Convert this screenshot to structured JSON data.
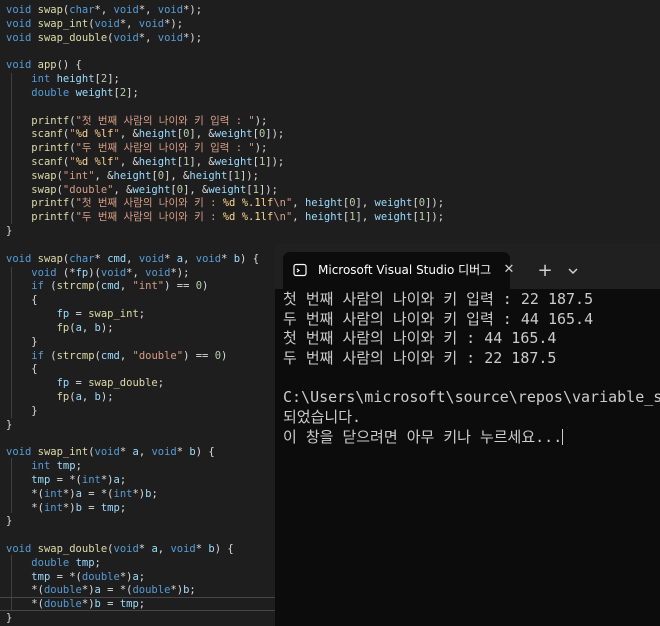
{
  "editor": {
    "lines": [
      [
        [
          "k",
          "void"
        ],
        [
          "p",
          " "
        ],
        [
          "f",
          "swap"
        ],
        [
          "p",
          "("
        ],
        [
          "k",
          "char"
        ],
        [
          "p",
          "*, "
        ],
        [
          "k",
          "void"
        ],
        [
          "p",
          "*, "
        ],
        [
          "k",
          "void"
        ],
        [
          "p",
          "*);"
        ]
      ],
      [
        [
          "k",
          "void"
        ],
        [
          "p",
          " "
        ],
        [
          "f",
          "swap_int"
        ],
        [
          "p",
          "("
        ],
        [
          "k",
          "void"
        ],
        [
          "p",
          "*, "
        ],
        [
          "k",
          "void"
        ],
        [
          "p",
          "*);"
        ]
      ],
      [
        [
          "k",
          "void"
        ],
        [
          "p",
          " "
        ],
        [
          "f",
          "swap_double"
        ],
        [
          "p",
          "("
        ],
        [
          "k",
          "void"
        ],
        [
          "p",
          "*, "
        ],
        [
          "k",
          "void"
        ],
        [
          "p",
          "*);"
        ]
      ],
      [],
      [
        [
          "k",
          "void"
        ],
        [
          "p",
          " "
        ],
        [
          "f",
          "app"
        ],
        [
          "p",
          "() {"
        ]
      ],
      [
        [
          "p",
          "    "
        ],
        [
          "k",
          "int"
        ],
        [
          "p",
          " "
        ],
        [
          "v",
          "height"
        ],
        [
          "p",
          "["
        ],
        [
          "n",
          "2"
        ],
        [
          "p",
          "];"
        ]
      ],
      [
        [
          "p",
          "    "
        ],
        [
          "k",
          "double"
        ],
        [
          "p",
          " "
        ],
        [
          "v",
          "weight"
        ],
        [
          "p",
          "["
        ],
        [
          "n",
          "2"
        ],
        [
          "p",
          "];"
        ]
      ],
      [],
      [
        [
          "p",
          "    "
        ],
        [
          "f",
          "printf"
        ],
        [
          "p",
          "("
        ],
        [
          "s",
          "\"첫 번째 사람의 나이와 키 입력 : \""
        ],
        [
          "p",
          ");"
        ]
      ],
      [
        [
          "p",
          "    "
        ],
        [
          "f",
          "scanf"
        ],
        [
          "p",
          "("
        ],
        [
          "s",
          "\""
        ],
        [
          "e",
          "%d %lf"
        ],
        [
          "s",
          "\""
        ],
        [
          "p",
          ", &"
        ],
        [
          "v",
          "height"
        ],
        [
          "p",
          "["
        ],
        [
          "n",
          "0"
        ],
        [
          "p",
          "], &"
        ],
        [
          "v",
          "weight"
        ],
        [
          "p",
          "["
        ],
        [
          "n",
          "0"
        ],
        [
          "p",
          "]);"
        ]
      ],
      [
        [
          "p",
          "    "
        ],
        [
          "f",
          "printf"
        ],
        [
          "p",
          "("
        ],
        [
          "s",
          "\"두 번째 사람의 나이와 키 입력 : \""
        ],
        [
          "p",
          ");"
        ]
      ],
      [
        [
          "p",
          "    "
        ],
        [
          "f",
          "scanf"
        ],
        [
          "p",
          "("
        ],
        [
          "s",
          "\""
        ],
        [
          "e",
          "%d %lf"
        ],
        [
          "s",
          "\""
        ],
        [
          "p",
          ", &"
        ],
        [
          "v",
          "height"
        ],
        [
          "p",
          "["
        ],
        [
          "n",
          "1"
        ],
        [
          "p",
          "], &"
        ],
        [
          "v",
          "weight"
        ],
        [
          "p",
          "["
        ],
        [
          "n",
          "1"
        ],
        [
          "p",
          "]);"
        ]
      ],
      [
        [
          "p",
          "    "
        ],
        [
          "f",
          "swap"
        ],
        [
          "p",
          "("
        ],
        [
          "s",
          "\"int\""
        ],
        [
          "p",
          ", &"
        ],
        [
          "v",
          "height"
        ],
        [
          "p",
          "["
        ],
        [
          "n",
          "0"
        ],
        [
          "p",
          "], &"
        ],
        [
          "v",
          "height"
        ],
        [
          "p",
          "["
        ],
        [
          "n",
          "1"
        ],
        [
          "p",
          "]);"
        ]
      ],
      [
        [
          "p",
          "    "
        ],
        [
          "f",
          "swap"
        ],
        [
          "p",
          "("
        ],
        [
          "s",
          "\"double\""
        ],
        [
          "p",
          ", &"
        ],
        [
          "v",
          "weight"
        ],
        [
          "p",
          "["
        ],
        [
          "n",
          "0"
        ],
        [
          "p",
          "], &"
        ],
        [
          "v",
          "weight"
        ],
        [
          "p",
          "["
        ],
        [
          "n",
          "1"
        ],
        [
          "p",
          "]);"
        ]
      ],
      [
        [
          "p",
          "    "
        ],
        [
          "f",
          "printf"
        ],
        [
          "p",
          "("
        ],
        [
          "s",
          "\"첫 번째 사람의 나이와 키 : "
        ],
        [
          "e",
          "%d %.1lf"
        ],
        [
          "s",
          "\\n\""
        ],
        [
          "p",
          ", "
        ],
        [
          "v",
          "height"
        ],
        [
          "p",
          "["
        ],
        [
          "n",
          "0"
        ],
        [
          "p",
          "], "
        ],
        [
          "v",
          "weight"
        ],
        [
          "p",
          "["
        ],
        [
          "n",
          "0"
        ],
        [
          "p",
          "]);"
        ]
      ],
      [
        [
          "p",
          "    "
        ],
        [
          "f",
          "printf"
        ],
        [
          "p",
          "("
        ],
        [
          "s",
          "\"두 번째 사람의 나이와 키 : "
        ],
        [
          "e",
          "%d %.1lf"
        ],
        [
          "s",
          "\\n\""
        ],
        [
          "p",
          ", "
        ],
        [
          "v",
          "height"
        ],
        [
          "p",
          "["
        ],
        [
          "n",
          "1"
        ],
        [
          "p",
          "], "
        ],
        [
          "v",
          "weight"
        ],
        [
          "p",
          "["
        ],
        [
          "n",
          "1"
        ],
        [
          "p",
          "]);"
        ]
      ],
      [
        [
          "p",
          "}"
        ]
      ],
      [],
      [
        [
          "k",
          "void"
        ],
        [
          "p",
          " "
        ],
        [
          "f",
          "swap"
        ],
        [
          "p",
          "("
        ],
        [
          "k",
          "char"
        ],
        [
          "p",
          "* "
        ],
        [
          "v",
          "cmd"
        ],
        [
          "p",
          ", "
        ],
        [
          "k",
          "void"
        ],
        [
          "p",
          "* "
        ],
        [
          "v",
          "a"
        ],
        [
          "p",
          ", "
        ],
        [
          "k",
          "void"
        ],
        [
          "p",
          "* "
        ],
        [
          "v",
          "b"
        ],
        [
          "p",
          ") {"
        ]
      ],
      [
        [
          "p",
          "    "
        ],
        [
          "k",
          "void"
        ],
        [
          "p",
          " (*"
        ],
        [
          "v",
          "fp"
        ],
        [
          "p",
          ")("
        ],
        [
          "k",
          "void"
        ],
        [
          "p",
          "*, "
        ],
        [
          "k",
          "void"
        ],
        [
          "p",
          "*);"
        ]
      ],
      [
        [
          "p",
          "    "
        ],
        [
          "k",
          "if"
        ],
        [
          "p",
          " ("
        ],
        [
          "f",
          "strcmp"
        ],
        [
          "p",
          "("
        ],
        [
          "v",
          "cmd"
        ],
        [
          "p",
          ", "
        ],
        [
          "s",
          "\"int\""
        ],
        [
          "p",
          ") == "
        ],
        [
          "n",
          "0"
        ],
        [
          "p",
          ")"
        ]
      ],
      [
        [
          "p",
          "    {"
        ]
      ],
      [
        [
          "p",
          "        "
        ],
        [
          "v",
          "fp"
        ],
        [
          "p",
          " = "
        ],
        [
          "f",
          "swap_int"
        ],
        [
          "p",
          ";"
        ]
      ],
      [
        [
          "p",
          "        "
        ],
        [
          "f",
          "fp"
        ],
        [
          "p",
          "("
        ],
        [
          "v",
          "a"
        ],
        [
          "p",
          ", "
        ],
        [
          "v",
          "b"
        ],
        [
          "p",
          ");"
        ]
      ],
      [
        [
          "p",
          "    }"
        ]
      ],
      [
        [
          "p",
          "    "
        ],
        [
          "k",
          "if"
        ],
        [
          "p",
          " ("
        ],
        [
          "f",
          "strcmp"
        ],
        [
          "p",
          "("
        ],
        [
          "v",
          "cmd"
        ],
        [
          "p",
          ", "
        ],
        [
          "s",
          "\"double\""
        ],
        [
          "p",
          ") == "
        ],
        [
          "n",
          "0"
        ],
        [
          "p",
          ")"
        ]
      ],
      [
        [
          "p",
          "    {"
        ]
      ],
      [
        [
          "p",
          "        "
        ],
        [
          "v",
          "fp"
        ],
        [
          "p",
          " = "
        ],
        [
          "f",
          "swap_double"
        ],
        [
          "p",
          ";"
        ]
      ],
      [
        [
          "p",
          "        "
        ],
        [
          "f",
          "fp"
        ],
        [
          "p",
          "("
        ],
        [
          "v",
          "a"
        ],
        [
          "p",
          ", "
        ],
        [
          "v",
          "b"
        ],
        [
          "p",
          ");"
        ]
      ],
      [
        [
          "p",
          "    }"
        ]
      ],
      [
        [
          "p",
          "}"
        ]
      ],
      [],
      [
        [
          "k",
          "void"
        ],
        [
          "p",
          " "
        ],
        [
          "f",
          "swap_int"
        ],
        [
          "p",
          "("
        ],
        [
          "k",
          "void"
        ],
        [
          "p",
          "* "
        ],
        [
          "v",
          "a"
        ],
        [
          "p",
          ", "
        ],
        [
          "k",
          "void"
        ],
        [
          "p",
          "* "
        ],
        [
          "v",
          "b"
        ],
        [
          "p",
          ") {"
        ]
      ],
      [
        [
          "p",
          "    "
        ],
        [
          "k",
          "int"
        ],
        [
          "p",
          " "
        ],
        [
          "v",
          "tmp"
        ],
        [
          "p",
          ";"
        ]
      ],
      [
        [
          "p",
          "    "
        ],
        [
          "v",
          "tmp"
        ],
        [
          "p",
          " = *("
        ],
        [
          "k",
          "int"
        ],
        [
          "p",
          "*)"
        ],
        [
          "v",
          "a"
        ],
        [
          "p",
          ";"
        ]
      ],
      [
        [
          "p",
          "    *("
        ],
        [
          "k",
          "int"
        ],
        [
          "p",
          "*)"
        ],
        [
          "v",
          "a"
        ],
        [
          "p",
          " = *("
        ],
        [
          "k",
          "int"
        ],
        [
          "p",
          "*)"
        ],
        [
          "v",
          "b"
        ],
        [
          "p",
          ";"
        ]
      ],
      [
        [
          "p",
          "    *("
        ],
        [
          "k",
          "int"
        ],
        [
          "p",
          "*)"
        ],
        [
          "v",
          "b"
        ],
        [
          "p",
          " = "
        ],
        [
          "v",
          "tmp"
        ],
        [
          "p",
          ";"
        ]
      ],
      [
        [
          "p",
          "}"
        ]
      ],
      [],
      [
        [
          "k",
          "void"
        ],
        [
          "p",
          " "
        ],
        [
          "f",
          "swap_double"
        ],
        [
          "p",
          "("
        ],
        [
          "k",
          "void"
        ],
        [
          "p",
          "* "
        ],
        [
          "v",
          "a"
        ],
        [
          "p",
          ", "
        ],
        [
          "k",
          "void"
        ],
        [
          "p",
          "* "
        ],
        [
          "v",
          "b"
        ],
        [
          "p",
          ") {"
        ]
      ],
      [
        [
          "p",
          "    "
        ],
        [
          "k",
          "double"
        ],
        [
          "p",
          " "
        ],
        [
          "v",
          "tmp"
        ],
        [
          "p",
          ";"
        ]
      ],
      [
        [
          "p",
          "    "
        ],
        [
          "v",
          "tmp"
        ],
        [
          "p",
          " = *("
        ],
        [
          "k",
          "double"
        ],
        [
          "p",
          "*)"
        ],
        [
          "v",
          "a"
        ],
        [
          "p",
          ";"
        ]
      ],
      [
        [
          "p",
          "    *("
        ],
        [
          "k",
          "double"
        ],
        [
          "p",
          "*)"
        ],
        [
          "v",
          "a"
        ],
        [
          "p",
          " = *("
        ],
        [
          "k",
          "double"
        ],
        [
          "p",
          "*)"
        ],
        [
          "v",
          "b"
        ],
        [
          "p",
          ";"
        ]
      ],
      [
        [
          "p",
          "    *("
        ],
        [
          "k",
          "double"
        ],
        [
          "p",
          "*)"
        ],
        [
          "v",
          "b"
        ],
        [
          "p",
          " = "
        ],
        [
          "v",
          "tmp"
        ],
        [
          "p",
          ";"
        ]
      ],
      [
        [
          "p",
          "}"
        ]
      ]
    ]
  },
  "terminal": {
    "tab_title": "Microsoft Visual Studio 디버그",
    "tab_icon": "console-window-icon",
    "close_symbol": "✕",
    "new_tab_symbol": "+",
    "dropdown_icon": "chevron-down-icon",
    "lines": [
      "첫 번째 사람의 나이와 키 입력 : 22 187.5",
      "두 번째 사람의 나이와 키 입력 : 44 165.4",
      "첫 번째 사람의 나이와 키 : 44 165.4",
      "두 번째 사람의 나이와 키 : 22 187.5",
      "",
      "C:\\Users\\microsoft\\source\\repos\\variable_s",
      "되었습니다.",
      "이 창을 닫으려면 아무 키나 누르세요..."
    ]
  }
}
